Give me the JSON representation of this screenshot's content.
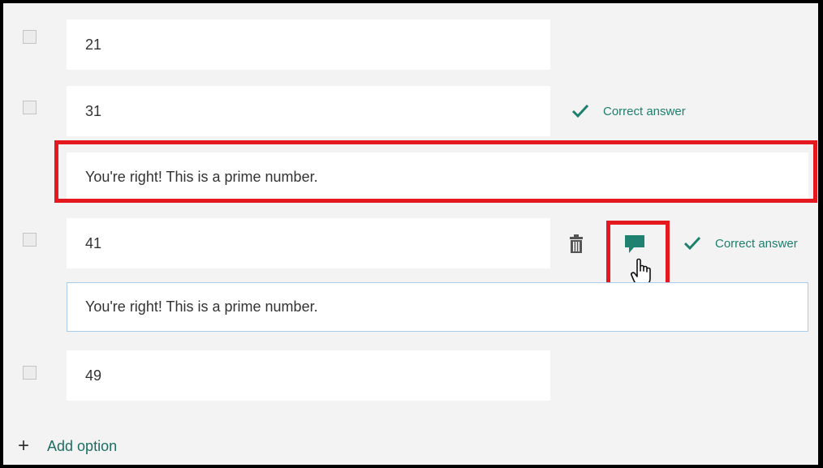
{
  "options": [
    {
      "value": "21"
    },
    {
      "value": "31",
      "correct_label": "Correct answer",
      "feedback": "You're right! This is a prime number."
    },
    {
      "value": "41",
      "correct_label": "Correct answer",
      "feedback": "You're right! This is a prime number."
    },
    {
      "value": "49"
    }
  ],
  "add_option_label": "Add option",
  "colors": {
    "accent": "#1d7f6e",
    "highlight": "#e3191f",
    "background": "#f3f3f3"
  },
  "icons": [
    "checkmark-icon",
    "trash-icon",
    "comment-icon",
    "hand-cursor-icon",
    "plus-icon"
  ]
}
